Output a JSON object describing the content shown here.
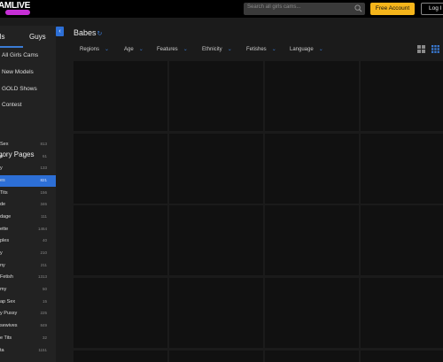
{
  "brand": {
    "logo_text": "AMLIVE"
  },
  "header": {
    "search_placeholder": "Search all girls cams...",
    "free_account": "Free Account",
    "login": "Log I"
  },
  "sidebar": {
    "tabs": [
      "rls",
      "Guys"
    ],
    "links": [
      "All Girls Cams",
      "New Models",
      "GOLD Shows",
      "Contest"
    ],
    "category_heading": "gory Pages",
    "categories": [
      {
        "name": "Sex",
        "count": "813"
      },
      {
        "name": "n",
        "count": "61"
      },
      {
        "name": "y",
        "count": "133"
      },
      {
        "name": "es",
        "count": "821"
      },
      {
        "name": "Tits",
        "count": "156"
      },
      {
        "name": "de",
        "count": "346"
      },
      {
        "name": "dage",
        "count": "111"
      },
      {
        "name": "ette",
        "count": "1464"
      },
      {
        "name": "ples",
        "count": "40"
      },
      {
        "name": "y",
        "count": "210"
      },
      {
        "name": "ny",
        "count": "211"
      },
      {
        "name": "Fetish",
        "count": "1313"
      },
      {
        "name": "my",
        "count": "50"
      },
      {
        "name": "ap Sex",
        "count": "15"
      },
      {
        "name": "y Pussy",
        "count": "225"
      },
      {
        "name": "sewives",
        "count": "849"
      },
      {
        "name": "e Tits",
        "count": "32"
      },
      {
        "name": "ta",
        "count": "1151"
      }
    ]
  },
  "main": {
    "title": "Babes",
    "filters": [
      "Regions",
      "Age",
      "Features",
      "Ethnicity",
      "Fetishes",
      "Language"
    ]
  },
  "colors": {
    "accent": "#2d6fd6",
    "gold": "#f5b51b",
    "logo_pink": "#c62fd6"
  }
}
